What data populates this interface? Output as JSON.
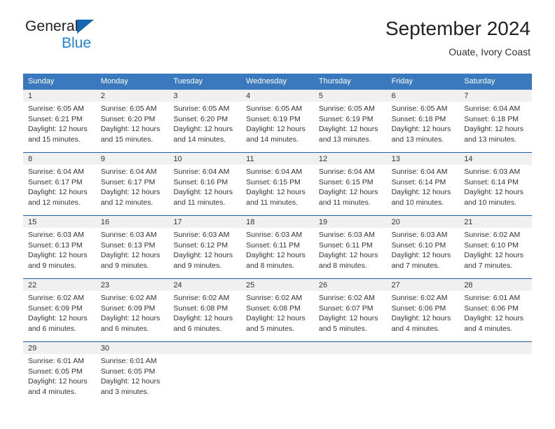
{
  "brand": {
    "name_top": "General",
    "name_bottom": "Blue",
    "triangle_color": "#1268b3",
    "blue_text_color": "#1f84d6"
  },
  "header": {
    "title": "September 2024",
    "subtitle": "Ouate, Ivory Coast"
  },
  "theme": {
    "header_blue": "#3b79be",
    "row_divider_blue": "#1f5fa5",
    "day_band_gray": "#f0f0f0",
    "text": "#333333"
  },
  "calendar": {
    "weekdays": [
      "Sunday",
      "Monday",
      "Tuesday",
      "Wednesday",
      "Thursday",
      "Friday",
      "Saturday"
    ],
    "weeks": [
      [
        {
          "day": "1",
          "sunrise": "Sunrise: 6:05 AM",
          "sunset": "Sunset: 6:21 PM",
          "daylight_line1": "Daylight: 12 hours",
          "daylight_line2": "and 15 minutes."
        },
        {
          "day": "2",
          "sunrise": "Sunrise: 6:05 AM",
          "sunset": "Sunset: 6:20 PM",
          "daylight_line1": "Daylight: 12 hours",
          "daylight_line2": "and 15 minutes."
        },
        {
          "day": "3",
          "sunrise": "Sunrise: 6:05 AM",
          "sunset": "Sunset: 6:20 PM",
          "daylight_line1": "Daylight: 12 hours",
          "daylight_line2": "and 14 minutes."
        },
        {
          "day": "4",
          "sunrise": "Sunrise: 6:05 AM",
          "sunset": "Sunset: 6:19 PM",
          "daylight_line1": "Daylight: 12 hours",
          "daylight_line2": "and 14 minutes."
        },
        {
          "day": "5",
          "sunrise": "Sunrise: 6:05 AM",
          "sunset": "Sunset: 6:19 PM",
          "daylight_line1": "Daylight: 12 hours",
          "daylight_line2": "and 13 minutes."
        },
        {
          "day": "6",
          "sunrise": "Sunrise: 6:05 AM",
          "sunset": "Sunset: 6:18 PM",
          "daylight_line1": "Daylight: 12 hours",
          "daylight_line2": "and 13 minutes."
        },
        {
          "day": "7",
          "sunrise": "Sunrise: 6:04 AM",
          "sunset": "Sunset: 6:18 PM",
          "daylight_line1": "Daylight: 12 hours",
          "daylight_line2": "and 13 minutes."
        }
      ],
      [
        {
          "day": "8",
          "sunrise": "Sunrise: 6:04 AM",
          "sunset": "Sunset: 6:17 PM",
          "daylight_line1": "Daylight: 12 hours",
          "daylight_line2": "and 12 minutes."
        },
        {
          "day": "9",
          "sunrise": "Sunrise: 6:04 AM",
          "sunset": "Sunset: 6:17 PM",
          "daylight_line1": "Daylight: 12 hours",
          "daylight_line2": "and 12 minutes."
        },
        {
          "day": "10",
          "sunrise": "Sunrise: 6:04 AM",
          "sunset": "Sunset: 6:16 PM",
          "daylight_line1": "Daylight: 12 hours",
          "daylight_line2": "and 11 minutes."
        },
        {
          "day": "11",
          "sunrise": "Sunrise: 6:04 AM",
          "sunset": "Sunset: 6:15 PM",
          "daylight_line1": "Daylight: 12 hours",
          "daylight_line2": "and 11 minutes."
        },
        {
          "day": "12",
          "sunrise": "Sunrise: 6:04 AM",
          "sunset": "Sunset: 6:15 PM",
          "daylight_line1": "Daylight: 12 hours",
          "daylight_line2": "and 11 minutes."
        },
        {
          "day": "13",
          "sunrise": "Sunrise: 6:04 AM",
          "sunset": "Sunset: 6:14 PM",
          "daylight_line1": "Daylight: 12 hours",
          "daylight_line2": "and 10 minutes."
        },
        {
          "day": "14",
          "sunrise": "Sunrise: 6:03 AM",
          "sunset": "Sunset: 6:14 PM",
          "daylight_line1": "Daylight: 12 hours",
          "daylight_line2": "and 10 minutes."
        }
      ],
      [
        {
          "day": "15",
          "sunrise": "Sunrise: 6:03 AM",
          "sunset": "Sunset: 6:13 PM",
          "daylight_line1": "Daylight: 12 hours",
          "daylight_line2": "and 9 minutes."
        },
        {
          "day": "16",
          "sunrise": "Sunrise: 6:03 AM",
          "sunset": "Sunset: 6:13 PM",
          "daylight_line1": "Daylight: 12 hours",
          "daylight_line2": "and 9 minutes."
        },
        {
          "day": "17",
          "sunrise": "Sunrise: 6:03 AM",
          "sunset": "Sunset: 6:12 PM",
          "daylight_line1": "Daylight: 12 hours",
          "daylight_line2": "and 9 minutes."
        },
        {
          "day": "18",
          "sunrise": "Sunrise: 6:03 AM",
          "sunset": "Sunset: 6:11 PM",
          "daylight_line1": "Daylight: 12 hours",
          "daylight_line2": "and 8 minutes."
        },
        {
          "day": "19",
          "sunrise": "Sunrise: 6:03 AM",
          "sunset": "Sunset: 6:11 PM",
          "daylight_line1": "Daylight: 12 hours",
          "daylight_line2": "and 8 minutes."
        },
        {
          "day": "20",
          "sunrise": "Sunrise: 6:03 AM",
          "sunset": "Sunset: 6:10 PM",
          "daylight_line1": "Daylight: 12 hours",
          "daylight_line2": "and 7 minutes."
        },
        {
          "day": "21",
          "sunrise": "Sunrise: 6:02 AM",
          "sunset": "Sunset: 6:10 PM",
          "daylight_line1": "Daylight: 12 hours",
          "daylight_line2": "and 7 minutes."
        }
      ],
      [
        {
          "day": "22",
          "sunrise": "Sunrise: 6:02 AM",
          "sunset": "Sunset: 6:09 PM",
          "daylight_line1": "Daylight: 12 hours",
          "daylight_line2": "and 6 minutes."
        },
        {
          "day": "23",
          "sunrise": "Sunrise: 6:02 AM",
          "sunset": "Sunset: 6:09 PM",
          "daylight_line1": "Daylight: 12 hours",
          "daylight_line2": "and 6 minutes."
        },
        {
          "day": "24",
          "sunrise": "Sunrise: 6:02 AM",
          "sunset": "Sunset: 6:08 PM",
          "daylight_line1": "Daylight: 12 hours",
          "daylight_line2": "and 6 minutes."
        },
        {
          "day": "25",
          "sunrise": "Sunrise: 6:02 AM",
          "sunset": "Sunset: 6:08 PM",
          "daylight_line1": "Daylight: 12 hours",
          "daylight_line2": "and 5 minutes."
        },
        {
          "day": "26",
          "sunrise": "Sunrise: 6:02 AM",
          "sunset": "Sunset: 6:07 PM",
          "daylight_line1": "Daylight: 12 hours",
          "daylight_line2": "and 5 minutes."
        },
        {
          "day": "27",
          "sunrise": "Sunrise: 6:02 AM",
          "sunset": "Sunset: 6:06 PM",
          "daylight_line1": "Daylight: 12 hours",
          "daylight_line2": "and 4 minutes."
        },
        {
          "day": "28",
          "sunrise": "Sunrise: 6:01 AM",
          "sunset": "Sunset: 6:06 PM",
          "daylight_line1": "Daylight: 12 hours",
          "daylight_line2": "and 4 minutes."
        }
      ],
      [
        {
          "day": "29",
          "sunrise": "Sunrise: 6:01 AM",
          "sunset": "Sunset: 6:05 PM",
          "daylight_line1": "Daylight: 12 hours",
          "daylight_line2": "and 4 minutes."
        },
        {
          "day": "30",
          "sunrise": "Sunrise: 6:01 AM",
          "sunset": "Sunset: 6:05 PM",
          "daylight_line1": "Daylight: 12 hours",
          "daylight_line2": "and 3 minutes."
        },
        {
          "day": "",
          "sunrise": "",
          "sunset": "",
          "daylight_line1": "",
          "daylight_line2": ""
        },
        {
          "day": "",
          "sunrise": "",
          "sunset": "",
          "daylight_line1": "",
          "daylight_line2": ""
        },
        {
          "day": "",
          "sunrise": "",
          "sunset": "",
          "daylight_line1": "",
          "daylight_line2": ""
        },
        {
          "day": "",
          "sunrise": "",
          "sunset": "",
          "daylight_line1": "",
          "daylight_line2": ""
        },
        {
          "day": "",
          "sunrise": "",
          "sunset": "",
          "daylight_line1": "",
          "daylight_line2": ""
        }
      ]
    ]
  }
}
